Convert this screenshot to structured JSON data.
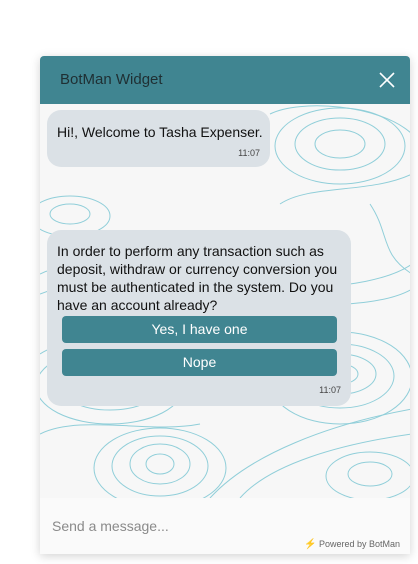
{
  "header": {
    "title": "BotMan Widget",
    "close_icon": "close-icon",
    "color": "#408591"
  },
  "messages": [
    {
      "text": "Hi!, Welcome to Tasha Expenser.",
      "time": "11:07"
    },
    {
      "text": "In order to perform any transaction such as deposit, withdraw or currency conversion you must be authenticated in the system. Do you have an account already?",
      "time": "11:07",
      "buttons": [
        "Yes, I have one",
        "Nope"
      ]
    }
  ],
  "footer": {
    "placeholder": "Send a message...",
    "powered_by": "Powered by BotMan",
    "powered_icon": "lightning-icon"
  },
  "colors": {
    "accent": "#408591",
    "bubble": "#dbe1e6",
    "contour": "#7fc8d4"
  }
}
